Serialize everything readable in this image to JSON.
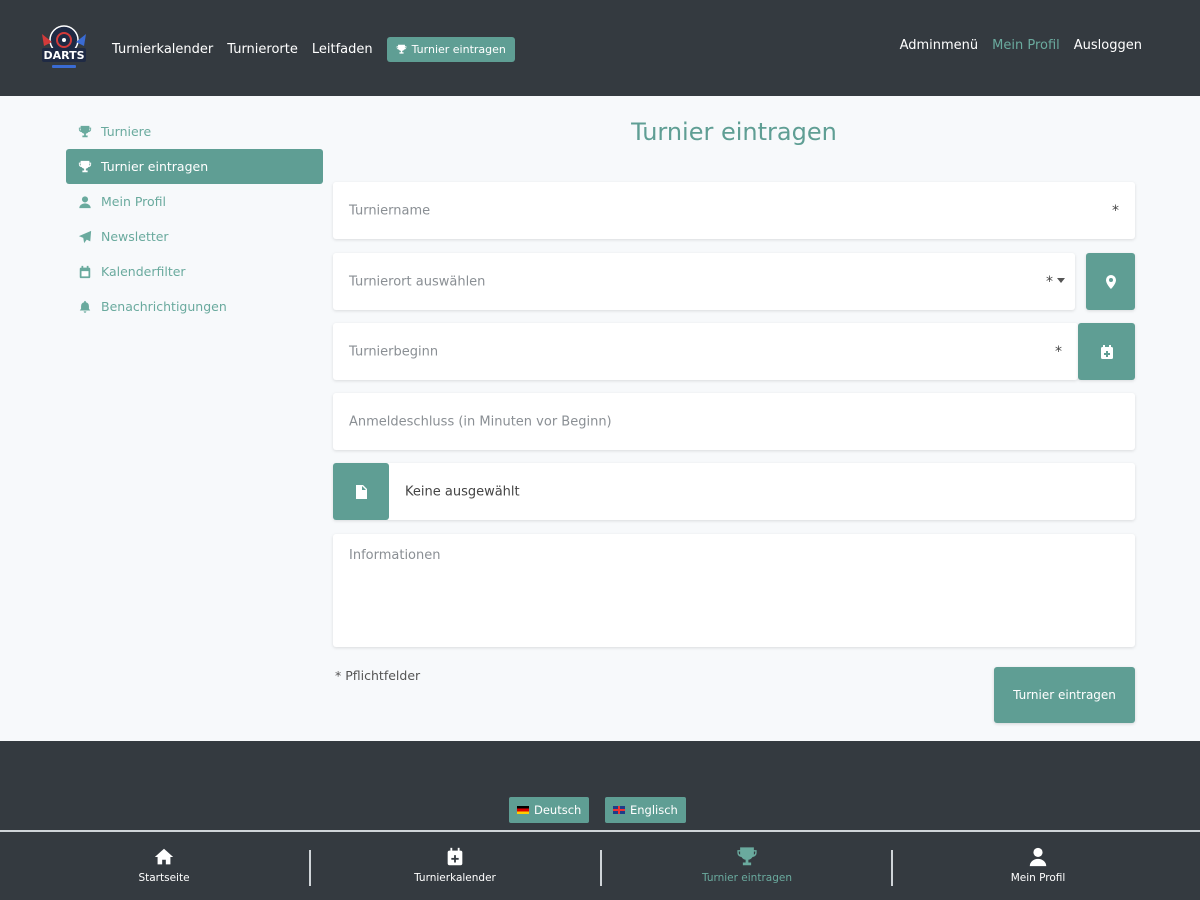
{
  "header": {
    "logo_text": "DARTS",
    "nav": [
      "Turnierkalender",
      "Turnierorte",
      "Leitfaden"
    ],
    "nav_button": "Turnier eintragen",
    "right": [
      "Adminmenü",
      "Mein Profil",
      "Ausloggen"
    ]
  },
  "sidebar": {
    "items": [
      {
        "label": "Turniere",
        "icon": "trophy-icon"
      },
      {
        "label": "Turnier eintragen",
        "icon": "trophy-icon"
      },
      {
        "label": "Mein Profil",
        "icon": "user-icon"
      },
      {
        "label": "Newsletter",
        "icon": "paper-plane-icon"
      },
      {
        "label": "Kalenderfilter",
        "icon": "calendar-icon"
      },
      {
        "label": "Benachrichtigungen",
        "icon": "bell-icon"
      }
    ]
  },
  "main": {
    "title": "Turnier eintragen",
    "fields": {
      "name": "Turniername",
      "location": "Turnierort auswählen",
      "start": "Turnierbeginn",
      "deadline": "Anmeldeschluss (in Minuten vor Beginn)",
      "file": "Keine ausgewählt",
      "info": "Informationen"
    },
    "required_marker": "*",
    "required_note": "Pflichtfelder",
    "submit": "Turnier eintragen"
  },
  "footer": {
    "languages": [
      "Deutsch",
      "Englisch"
    ]
  },
  "bottom_nav": [
    "Startseite",
    "Turnierkalender",
    "Turnier eintragen",
    "Mein Profil"
  ],
  "colors": {
    "accent": "#5f9e94",
    "dark": "#343a40",
    "background": "#f7f9fb"
  }
}
